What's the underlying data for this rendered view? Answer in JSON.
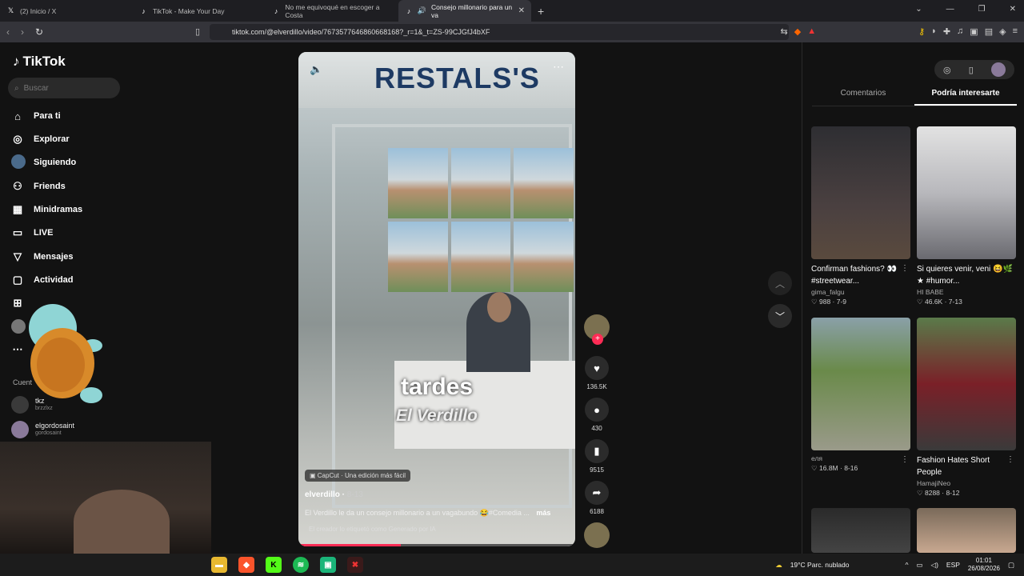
{
  "browser": {
    "tabs": [
      {
        "icon": "x-logo-icon",
        "title": "(2) Inicio / X",
        "active": false
      },
      {
        "icon": "tiktok-icon",
        "title": "TikTok - Make Your Day",
        "active": false
      },
      {
        "icon": "tiktok-icon",
        "title": "No me equivoqué en escoger a Costa",
        "active": false
      },
      {
        "icon": "tiktok-icon",
        "title": "Consejo millonario para un va",
        "active": true
      }
    ],
    "url": "tiktok.com/@elverdillo/video/7673577646860668168?_r=1&_t=ZS-99CJGfJ4bXF"
  },
  "sidebar": {
    "logo": "TikTok",
    "search_placeholder": "Buscar",
    "items": [
      {
        "label": "Para ti",
        "icon": "home-icon"
      },
      {
        "label": "Explorar",
        "icon": "compass-icon"
      },
      {
        "label": "Siguiendo",
        "icon": "following-avatar-icon"
      },
      {
        "label": "Friends",
        "icon": "friends-icon"
      },
      {
        "label": "Minidramas",
        "icon": "minidramas-icon"
      },
      {
        "label": "LIVE",
        "icon": "live-icon"
      },
      {
        "label": "Mensajes",
        "icon": "messages-icon"
      },
      {
        "label": "Actividad",
        "icon": "activity-icon"
      }
    ],
    "accounts_label": "Cuent",
    "accounts": [
      {
        "name": "tkz",
        "handle": "brzzlxz"
      },
      {
        "name": "elgordosaint",
        "handle": "gordosaint"
      }
    ]
  },
  "video": {
    "sign_text": "RESTALS'S",
    "overlay_big": "tardes",
    "overlay_small": "El Verdillo",
    "capcut_label": "CapCut · Una edición más fácil",
    "author": "elverdillo",
    "date": "8-13",
    "description": "El Verdillo le da un consejo millonario a un vagabundo 😂#Comedia ...",
    "more_label": "más",
    "ai_label": "El creador lo etiquetó como Generado por IA",
    "progress": 0.37
  },
  "actions": {
    "likes": "136.5K",
    "comments": "430",
    "saves": "9515",
    "shares": "6188"
  },
  "right_panel": {
    "tabs": [
      "Comentarios",
      "Podría interesarte"
    ],
    "active_tab": 1,
    "cards": [
      {
        "title": "Confirman fashions? 👀 #streetwear...",
        "user": "gima_falgu",
        "likes": "988",
        "date": "7-9",
        "colors": [
          "#3a3a3e",
          "#6a5a50"
        ]
      },
      {
        "title": "Si quieres venir, veni 😆🌿★ #humor...",
        "user": "HI BABE",
        "likes": "46.6K",
        "date": "7-13",
        "colors": [
          "#d8d8d8",
          "#8a8a8a"
        ]
      },
      {
        "title": "",
        "user": "еля",
        "likes": "16.8M",
        "date": "8-16",
        "colors": [
          "#6a8a4a",
          "#9aa08a"
        ]
      },
      {
        "title": "Fashion Hates Short People",
        "user": "HamajiNeo",
        "likes": "8288",
        "date": "8-12",
        "colors": [
          "#4a6a3a",
          "#7a1a20"
        ]
      }
    ]
  },
  "taskbar": {
    "weather": "19°C  Parc. nublado",
    "lang": "ESP",
    "time": "01:01",
    "date": "26/08/2026"
  }
}
